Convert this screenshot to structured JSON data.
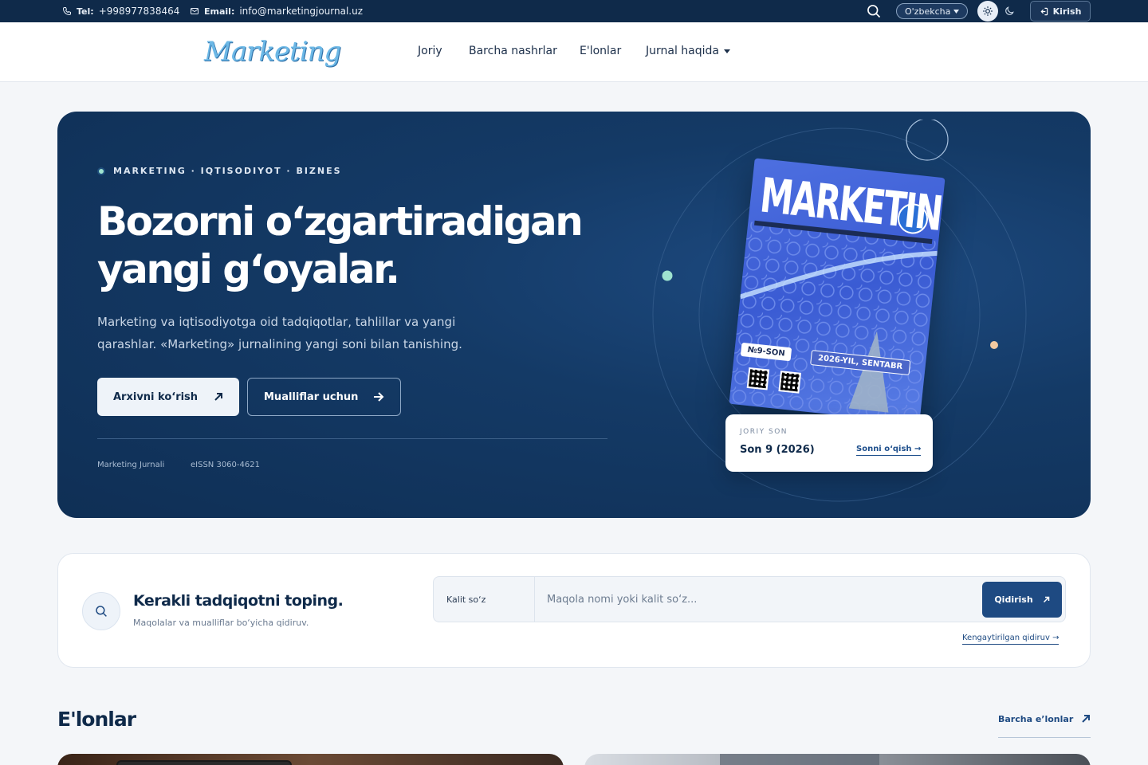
{
  "topbar": {
    "tel_label": "Tel:",
    "tel_value": "+998977838464",
    "email_label": "Email:",
    "email_value": "info@marketingjournal.uz",
    "language": "O'zbekcha",
    "login": "Kirish"
  },
  "header": {
    "logo_text": "Marketing",
    "nav": [
      "Joriy",
      "Barcha nashrlar",
      "E'lonlar",
      "Jurnal haqida"
    ]
  },
  "hero": {
    "eyebrow": "MARKETING · IQTISODIYOT · BIZNES",
    "title_line1": "Bozorni o‘zgartiradigan",
    "title_line2": "yangi g‘oyalar.",
    "description": "Marketing va iqtisodiyotga oid tadqiqotlar, tahlillar va yangi qarashlar. «Marketing» jurnalining yangi soni bilan tanishing.",
    "btn_archive": "Arxivni ko‘rish",
    "btn_authors": "Mualliflar uchun",
    "meta_journal": "Marketing Jurnali",
    "meta_issn": "eISSN 3060-4621",
    "cover": {
      "title": "MARKETING",
      "issue": "№9-SON",
      "date": "2026-YIL, SENTABR"
    },
    "issue_card": {
      "label": "JORIY SON",
      "name": "Son 9 (2026)",
      "link": "Sonni o‘qish →"
    }
  },
  "search": {
    "title": "Kerakli tadqiqotni toping.",
    "subtitle": "Maqolalar va mualliflar bo‘yicha qidiruv.",
    "field_label": "Kalit so‘z",
    "placeholder": "Maqola nomi yoki kalit so‘z...",
    "value": "",
    "button": "Qidirish",
    "advanced": "Kengaytirilgan qidiruv →"
  },
  "announcements": {
    "title": "E'lonlar",
    "all_link": "Barcha e’lonlar"
  },
  "colors": {
    "navy": "#0f2a4a",
    "accent": "#1e4a82",
    "mint": "#9fe3cf",
    "peach": "#f2c9a0"
  }
}
